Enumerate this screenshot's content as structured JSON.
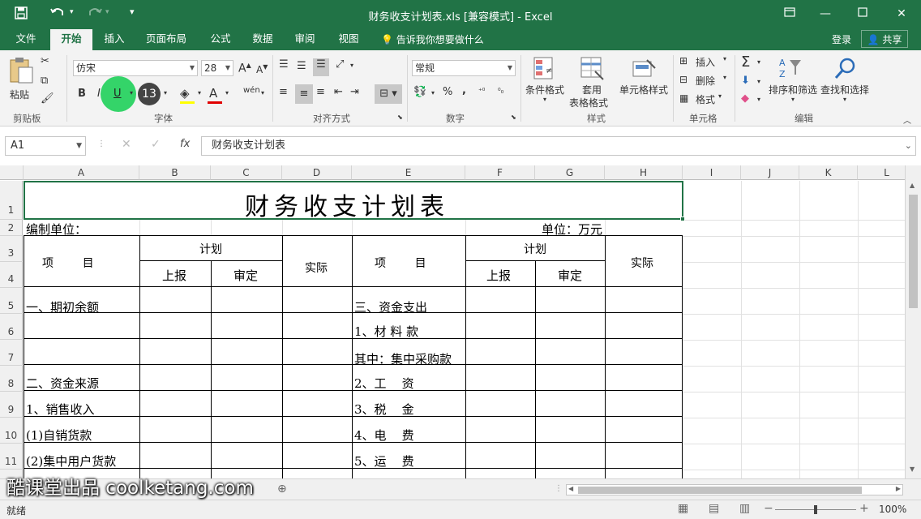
{
  "window": {
    "title": "财务收支计划表.xls  [兼容模式] - Excel",
    "undo_icon": "undo-icon",
    "redo_icon": "redo-icon",
    "save_icon": "save-icon"
  },
  "tabs": [
    {
      "label": "文件"
    },
    {
      "label": "开始",
      "active": true
    },
    {
      "label": "插入"
    },
    {
      "label": "页面布局"
    },
    {
      "label": "公式"
    },
    {
      "label": "数据"
    },
    {
      "label": "审阅"
    },
    {
      "label": "视图"
    }
  ],
  "tell_me": "告诉我你想要做什么",
  "account": {
    "login": "登录",
    "share": "共享"
  },
  "ribbon": {
    "clipboard": {
      "paste": "粘贴",
      "group": "剪贴板"
    },
    "font": {
      "name": "仿宋",
      "size": "28",
      "group": "字体",
      "size_badge": "13",
      "bold": "B",
      "italic": "I",
      "underline": "U",
      "phonetic": "wén"
    },
    "alignment": {
      "group": "对齐方式"
    },
    "number": {
      "format": "常规",
      "percent": "%",
      "comma": ",",
      "group": "数字"
    },
    "styles": {
      "cond": "条件格式",
      "table1": "套用",
      "table2": "表格格式",
      "cell": "单元格样式",
      "group": "样式"
    },
    "cells": {
      "insert": "插入",
      "delete": "删除",
      "format": "格式",
      "group": "单元格"
    },
    "editing": {
      "sort": "排序和筛选",
      "find": "查找和选择",
      "group": "编辑"
    },
    "accent": "#217346"
  },
  "formula_bar": {
    "name_box": "A1",
    "fx": "fx",
    "content": "财务收支计划表"
  },
  "columns": [
    "A",
    "B",
    "C",
    "D",
    "E",
    "F",
    "G",
    "H",
    "I",
    "J",
    "K",
    "L"
  ],
  "rows": [
    "1",
    "2",
    "3",
    "4",
    "5",
    "6",
    "7",
    "8",
    "9",
    "10",
    "11"
  ],
  "sheet": {
    "title": "财务收支计划表",
    "unit_left": "编制单位：",
    "unit_right": "单位：万元",
    "item_header": "项        目",
    "plan": "计划",
    "report": "上报",
    "approve": "审定",
    "actual": "实际",
    "left_items": [
      "一、期初余额",
      "",
      "",
      "二、资金来源",
      "1、销售收入",
      "(1)自销货款",
      "(2)集中用户货款"
    ],
    "right_items": [
      "三、资金支出",
      "1、材 料 款",
      "其中：集中采购款",
      "2、工    资",
      "3、税    金",
      "4、电    费",
      "5、运    费"
    ]
  },
  "watermark": "酷课堂出品 coolketang.com",
  "status": {
    "ready": "就绪",
    "zoom": "100%"
  }
}
